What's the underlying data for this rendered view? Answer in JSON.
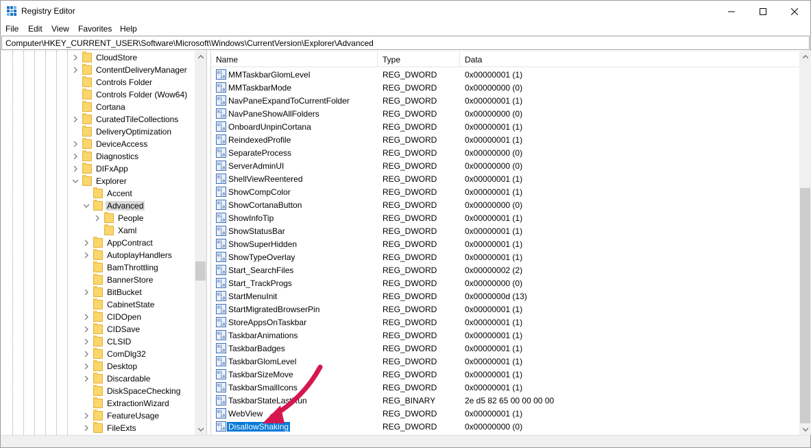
{
  "window": {
    "title": "Registry Editor",
    "accent": "#0078d7"
  },
  "menu": [
    "File",
    "Edit",
    "View",
    "Favorites",
    "Help"
  ],
  "address": {
    "path": "Computer\\HKEY_CURRENT_USER\\Software\\Microsoft\\Windows\\CurrentVersion\\Explorer\\Advanced"
  },
  "tree": {
    "items": [
      {
        "label": "CloudStore",
        "expander": "collapsed",
        "selected": false
      },
      {
        "label": "ContentDeliveryManager",
        "expander": "collapsed",
        "selected": false
      },
      {
        "label": "Controls Folder",
        "expander": "none",
        "selected": false
      },
      {
        "label": "Controls Folder (Wow64)",
        "expander": "none",
        "selected": false
      },
      {
        "label": "Cortana",
        "expander": "none",
        "selected": false
      },
      {
        "label": "CuratedTileCollections",
        "expander": "collapsed",
        "selected": false
      },
      {
        "label": "DeliveryOptimization",
        "expander": "none",
        "selected": false
      },
      {
        "label": "DeviceAccess",
        "expander": "collapsed",
        "selected": false
      },
      {
        "label": "Diagnostics",
        "expander": "collapsed",
        "selected": false
      },
      {
        "label": "DIFxApp",
        "expander": "collapsed",
        "selected": false
      },
      {
        "label": "Explorer",
        "expander": "expanded",
        "selected": false
      },
      {
        "label": "Accent",
        "expander": "none",
        "selected": false
      },
      {
        "label": "Advanced",
        "expander": "expanded",
        "selected": true
      },
      {
        "label": "People",
        "expander": "collapsed",
        "selected": false
      },
      {
        "label": "Xaml",
        "expander": "none",
        "selected": false
      },
      {
        "label": "AppContract",
        "expander": "collapsed",
        "selected": false
      },
      {
        "label": "AutoplayHandlers",
        "expander": "collapsed",
        "selected": false
      },
      {
        "label": "BamThrottling",
        "expander": "none",
        "selected": false
      },
      {
        "label": "BannerStore",
        "expander": "none",
        "selected": false
      },
      {
        "label": "BitBucket",
        "expander": "collapsed",
        "selected": false
      },
      {
        "label": "CabinetState",
        "expander": "none",
        "selected": false
      },
      {
        "label": "CIDOpen",
        "expander": "collapsed",
        "selected": false
      },
      {
        "label": "CIDSave",
        "expander": "collapsed",
        "selected": false
      },
      {
        "label": "CLSID",
        "expander": "collapsed",
        "selected": false
      },
      {
        "label": "ComDlg32",
        "expander": "collapsed",
        "selected": false
      },
      {
        "label": "Desktop",
        "expander": "collapsed",
        "selected": false
      },
      {
        "label": "Discardable",
        "expander": "collapsed",
        "selected": false
      },
      {
        "label": "DiskSpaceChecking",
        "expander": "none",
        "selected": false
      },
      {
        "label": "ExtractionWizard",
        "expander": "none",
        "selected": false
      },
      {
        "label": "FeatureUsage",
        "expander": "collapsed",
        "selected": false
      },
      {
        "label": "FileExts",
        "expander": "collapsed",
        "selected": false
      }
    ]
  },
  "list": {
    "columns": [
      "Name",
      "Type",
      "Data"
    ],
    "rows": [
      {
        "name": "MMTaskbarGlomLevel",
        "type": "REG_DWORD",
        "data": "0x00000001 (1)",
        "selected": false
      },
      {
        "name": "MMTaskbarMode",
        "type": "REG_DWORD",
        "data": "0x00000000 (0)",
        "selected": false
      },
      {
        "name": "NavPaneExpandToCurrentFolder",
        "type": "REG_DWORD",
        "data": "0x00000001 (1)",
        "selected": false
      },
      {
        "name": "NavPaneShowAllFolders",
        "type": "REG_DWORD",
        "data": "0x00000000 (0)",
        "selected": false
      },
      {
        "name": "OnboardUnpinCortana",
        "type": "REG_DWORD",
        "data": "0x00000001 (1)",
        "selected": false
      },
      {
        "name": "ReindexedProfile",
        "type": "REG_DWORD",
        "data": "0x00000001 (1)",
        "selected": false
      },
      {
        "name": "SeparateProcess",
        "type": "REG_DWORD",
        "data": "0x00000000 (0)",
        "selected": false
      },
      {
        "name": "ServerAdminUI",
        "type": "REG_DWORD",
        "data": "0x00000000 (0)",
        "selected": false
      },
      {
        "name": "ShellViewReentered",
        "type": "REG_DWORD",
        "data": "0x00000001 (1)",
        "selected": false
      },
      {
        "name": "ShowCompColor",
        "type": "REG_DWORD",
        "data": "0x00000001 (1)",
        "selected": false
      },
      {
        "name": "ShowCortanaButton",
        "type": "REG_DWORD",
        "data": "0x00000000 (0)",
        "selected": false
      },
      {
        "name": "ShowInfoTip",
        "type": "REG_DWORD",
        "data": "0x00000001 (1)",
        "selected": false
      },
      {
        "name": "ShowStatusBar",
        "type": "REG_DWORD",
        "data": "0x00000001 (1)",
        "selected": false
      },
      {
        "name": "ShowSuperHidden",
        "type": "REG_DWORD",
        "data": "0x00000001 (1)",
        "selected": false
      },
      {
        "name": "ShowTypeOverlay",
        "type": "REG_DWORD",
        "data": "0x00000001 (1)",
        "selected": false
      },
      {
        "name": "Start_SearchFiles",
        "type": "REG_DWORD",
        "data": "0x00000002 (2)",
        "selected": false
      },
      {
        "name": "Start_TrackProgs",
        "type": "REG_DWORD",
        "data": "0x00000000 (0)",
        "selected": false
      },
      {
        "name": "StartMenuInit",
        "type": "REG_DWORD",
        "data": "0x0000000d (13)",
        "selected": false
      },
      {
        "name": "StartMigratedBrowserPin",
        "type": "REG_DWORD",
        "data": "0x00000001 (1)",
        "selected": false
      },
      {
        "name": "StoreAppsOnTaskbar",
        "type": "REG_DWORD",
        "data": "0x00000001 (1)",
        "selected": false
      },
      {
        "name": "TaskbarAnimations",
        "type": "REG_DWORD",
        "data": "0x00000001 (1)",
        "selected": false
      },
      {
        "name": "TaskbarBadges",
        "type": "REG_DWORD",
        "data": "0x00000001 (1)",
        "selected": false
      },
      {
        "name": "TaskbarGlomLevel",
        "type": "REG_DWORD",
        "data": "0x00000001 (1)",
        "selected": false
      },
      {
        "name": "TaskbarSizeMove",
        "type": "REG_DWORD",
        "data": "0x00000001 (1)",
        "selected": false
      },
      {
        "name": "TaskbarSmallIcons",
        "type": "REG_DWORD",
        "data": "0x00000001 (1)",
        "selected": false
      },
      {
        "name": "TaskbarStateLastRun",
        "type": "REG_BINARY",
        "data": "2e d5 82 65 00 00 00 00",
        "selected": false
      },
      {
        "name": "WebView",
        "type": "REG_DWORD",
        "data": "0x00000001 (1)",
        "selected": false
      },
      {
        "name": "DisallowShaking",
        "type": "REG_DWORD",
        "data": "0x00000000 (0)",
        "selected": true
      }
    ]
  },
  "annotation": {
    "arrow_color": "#d6164f"
  }
}
